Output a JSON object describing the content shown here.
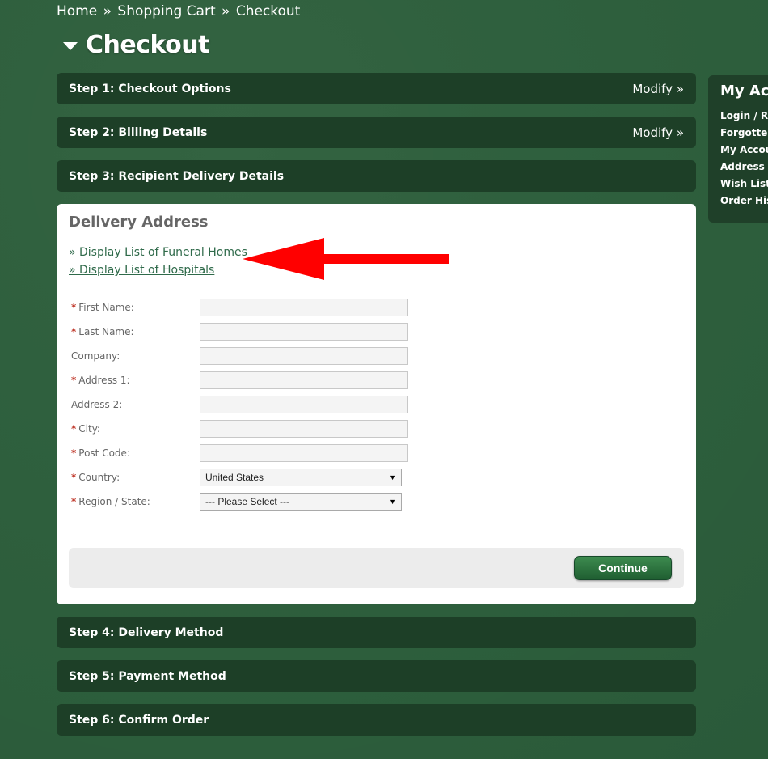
{
  "breadcrumb": {
    "items": [
      "Home",
      "Shopping Cart",
      "Checkout"
    ],
    "separator": "»"
  },
  "page": {
    "title": "Checkout"
  },
  "steps": [
    {
      "label": "Step 1: Checkout Options",
      "modify": "Modify »"
    },
    {
      "label": "Step 2: Billing Details",
      "modify": "Modify »"
    },
    {
      "label": "Step 3: Recipient Delivery Details"
    },
    {
      "label": "Step 4: Delivery Method"
    },
    {
      "label": "Step 5: Payment Method"
    },
    {
      "label": "Step 6: Confirm Order"
    }
  ],
  "delivery": {
    "heading": "Delivery Address",
    "link_funeral": "» Display List of Funeral Homes",
    "link_hospitals": "» Display List of Hospitals",
    "fields": {
      "first_name": {
        "label": "First Name:",
        "required": "*",
        "value": ""
      },
      "last_name": {
        "label": "Last Name:",
        "required": "*",
        "value": ""
      },
      "company": {
        "label": "Company:",
        "value": ""
      },
      "address1": {
        "label": "Address 1:",
        "required": "*",
        "value": ""
      },
      "address2": {
        "label": "Address 2:",
        "value": ""
      },
      "city": {
        "label": "City:",
        "required": "*",
        "value": ""
      },
      "postcode": {
        "label": "Post Code:",
        "required": "*",
        "value": ""
      },
      "country": {
        "label": "Country:",
        "required": "*",
        "value": "United States"
      },
      "region": {
        "label": "Region / State:",
        "required": "*",
        "value": "--- Please Select ---"
      }
    },
    "continue_label": "Continue"
  },
  "sidebar": {
    "title": "My Account",
    "items": [
      "Login / Register",
      "Forgotten Password",
      "My Account",
      "Address Book",
      "Wish List",
      "Order History"
    ]
  },
  "colors": {
    "background": "#2c5e3b",
    "step_bar": "#1d3f27",
    "arrow": "#ff0000",
    "link": "#2f6a4a",
    "required": "#c0392b",
    "button": "#2a7040"
  },
  "icons": {
    "title_caret": "caret-down-icon",
    "select_dropdown": "dropdown-arrow-icon",
    "annotation": "red-arrow-icon"
  }
}
